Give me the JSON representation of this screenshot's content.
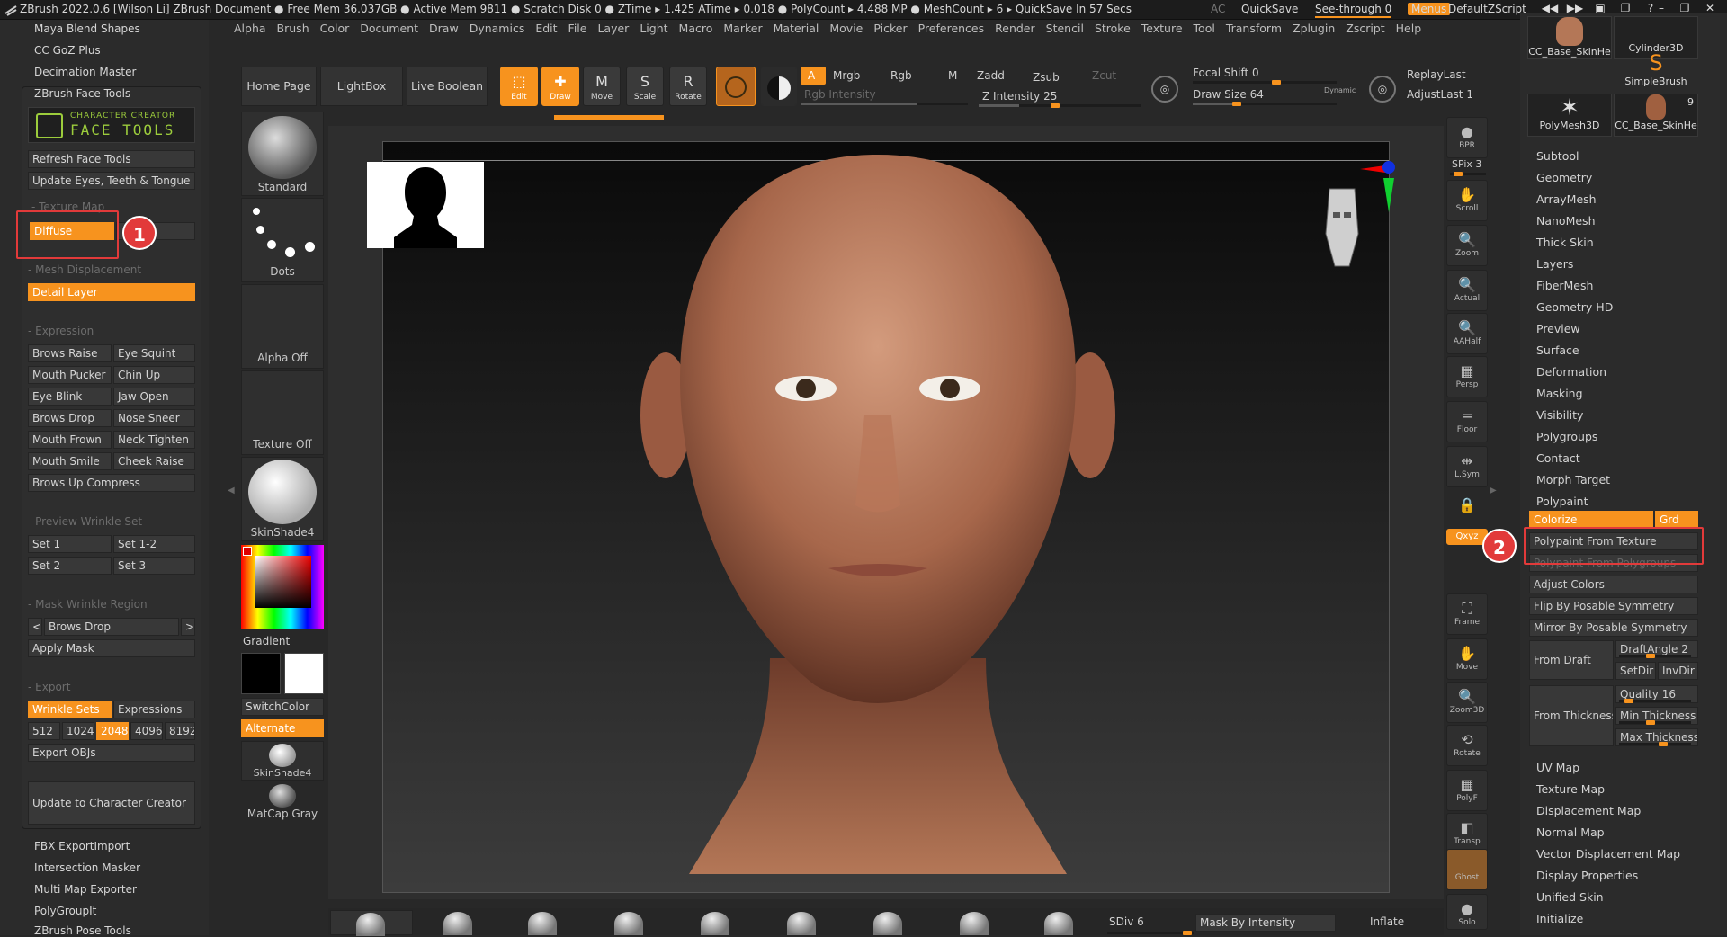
{
  "titlebar": {
    "text": "ZBrush 2022.0.6 [Wilson Li]   ZBrush Document    ● Free Mem 36.037GB ● Active Mem 9811 ● Scratch Disk 0 ● ZTime ▸ 1.425 ATime ▸ 0.018 ● PolyCount ▸ 4.488 MP ● MeshCount ▸ 6  ▸ QuickSave In 57 Secs",
    "ac": "AC",
    "quicksave": "QuickSave",
    "seethrough": "See-through   0",
    "menus": "Menus",
    "script": "DefaultZScript"
  },
  "menubar": [
    "Alpha",
    "Brush",
    "Color",
    "Document",
    "Draw",
    "Dynamics",
    "Edit",
    "File",
    "Layer",
    "Light",
    "Macro",
    "Marker",
    "Material",
    "Movie",
    "Picker",
    "Preferences",
    "Render",
    "Stencil",
    "Stroke",
    "Texture",
    "Tool",
    "Transform",
    "Zplugin",
    "Zscript",
    "Help"
  ],
  "left_tray": {
    "top_items": [
      "Maya Blend Shapes",
      "CC GoZ Plus",
      "Decimation Master",
      "ZBrush Face Tools"
    ],
    "bottom_items": [
      "FBX ExportImport",
      "Intersection Masker",
      "Multi Map Exporter",
      "PolyGroupIt",
      "ZBrush Pose Tools"
    ]
  },
  "face_tools": {
    "logo_top": "CHARACTER CREATOR",
    "logo_main": "FACE TOOLS",
    "refresh": "Refresh Face Tools",
    "update_eyes": "Update Eyes, Teeth & Tongue",
    "texture_map": "- Texture Map",
    "diffuse": "Diffuse",
    "mesh_disp": "- Mesh Displacement",
    "detail_layer": "Detail Layer",
    "expression": "- Expression",
    "expr_buttons": [
      [
        "Brows Raise",
        "Eye Squint"
      ],
      [
        "Mouth Pucker",
        "Chin Up"
      ],
      [
        "Eye Blink",
        "Jaw Open"
      ],
      [
        "Brows Drop",
        "Nose Sneer"
      ],
      [
        "Mouth Frown",
        "Neck Tighten"
      ],
      [
        "Mouth Smile",
        "Cheek Raise"
      ]
    ],
    "brows_up": "Brows Up Compress",
    "preview_wrinkle": "- Preview Wrinkle Set",
    "sets": [
      [
        "Set 1",
        "Set 1-2"
      ],
      [
        "Set 2",
        "Set 3"
      ]
    ],
    "mask_wrinkle": "- Mask Wrinkle Region",
    "prev": "<",
    "brows_drop": "Brows Drop",
    "next": ">",
    "apply_mask": "Apply Mask",
    "export": "- Export",
    "wrinkle_sets": "Wrinkle Sets",
    "expressions": "Expressions",
    "sizes": [
      "512",
      "1024",
      "2048",
      "4096",
      "8192"
    ],
    "export_objs": "Export OBJs",
    "update_cc": "Update to Character Creator"
  },
  "badges": {
    "one": "1",
    "two": "2"
  },
  "top_shelf": {
    "home": "Home Page",
    "lightbox": "LightBox",
    "liveboolean": "Live Boolean",
    "edit": "Edit",
    "draw": "Draw",
    "move": "Move",
    "scale": "Scale",
    "rotate": "Rotate",
    "a": "A",
    "mrgb": "Mrgb",
    "rgb": "Rgb",
    "m": "M",
    "rgb_intensity": "Rgb Intensity",
    "zadd": "Zadd",
    "zsub": "Zsub",
    "zcut": "Zcut",
    "z_intensity": "Z Intensity 25",
    "focal_shift": "Focal Shift 0",
    "draw_size": "Draw Size 64",
    "dynamic": "Dynamic",
    "replay_last": "ReplayLast",
    "adjust_last": "AdjustLast 1"
  },
  "left_shelf": {
    "standard": "Standard",
    "dots": "Dots",
    "alpha_off": "Alpha Off",
    "texture_off": "Texture Off",
    "skinshade4": "SkinShade4",
    "gradient": "Gradient",
    "switchcolor": "SwitchColor",
    "alternate": "Alternate",
    "skinshade4_b": "SkinShade4",
    "matcap_gray": "MatCap Gray"
  },
  "right_shelf": [
    {
      "label": "BPR",
      "icon": "●"
    },
    {
      "label": "SPix 3",
      "icon": ""
    },
    {
      "label": "Scroll",
      "icon": "✋"
    },
    {
      "label": "Zoom",
      "icon": "🔍"
    },
    {
      "label": "Actual",
      "icon": "🔍"
    },
    {
      "label": "AAHalf",
      "icon": "🔍"
    },
    {
      "label": "Persp",
      "icon": "▦"
    },
    {
      "label": "Floor",
      "icon": "═"
    },
    {
      "label": "L.Sym",
      "icon": "⇹"
    },
    {
      "label": "",
      "icon": "🔒"
    },
    {
      "label": "Qxyz",
      "icon": ""
    },
    {
      "label": "Frame",
      "icon": "⛶"
    },
    {
      "label": "Move",
      "icon": "✋"
    },
    {
      "label": "Zoom3D",
      "icon": "🔍"
    },
    {
      "label": "Rotate",
      "icon": "⟲"
    },
    {
      "label": "PolyF",
      "icon": "▦"
    },
    {
      "label": "Transp",
      "icon": "◧"
    },
    {
      "label": "Ghost",
      "icon": ""
    },
    {
      "label": "Solo",
      "icon": "●"
    }
  ],
  "tool_thumbs": [
    {
      "label": "CC_Base_SkinHe"
    },
    {
      "label": "Cylinder3D"
    },
    {
      "label": "SimpleBrush"
    },
    {
      "label": "PolyMesh3D"
    },
    {
      "label": "CC_Base_SkinHe"
    },
    {
      "label": "9"
    }
  ],
  "right_panel": {
    "top_items": [
      "Subtool",
      "Geometry",
      "ArrayMesh",
      "NanoMesh",
      "Thick Skin",
      "Layers",
      "FiberMesh",
      "Geometry HD",
      "Preview",
      "Surface",
      "Deformation",
      "Masking",
      "Visibility",
      "Polygroups",
      "Contact",
      "Morph Target",
      "Polypaint"
    ],
    "colorize": "Colorize",
    "grd": "Grd",
    "polypaint_from_texture": "Polypaint From Texture",
    "polypaint_from_polygroups": "Polypaint From Polygroups",
    "adjust_colors": "Adjust Colors",
    "flip": "Flip By Posable Symmetry",
    "mirror": "Mirror By Posable Symmetry",
    "from_draft": "From Draft",
    "draft_angle": "DraftAngle 2",
    "setdir": "SetDir",
    "invdir": "InvDir",
    "from_thickness": "From Thickness",
    "quality": "Quality 16",
    "min_thickness": "Min Thickness",
    "max_thickness": "Max Thickness",
    "bottom_items": [
      "UV Map",
      "Texture Map",
      "Displacement Map",
      "Normal Map",
      "Vector Displacement Map",
      "Display Properties",
      "Unified Skin",
      "Initialize"
    ]
  },
  "bottom": {
    "sdiv": "SDiv 6",
    "mask_by_intensity": "Mask By Intensity",
    "inflate": "Inflate"
  },
  "colors": {
    "accent": "#f7931e",
    "highlight": "#e23a3a"
  }
}
